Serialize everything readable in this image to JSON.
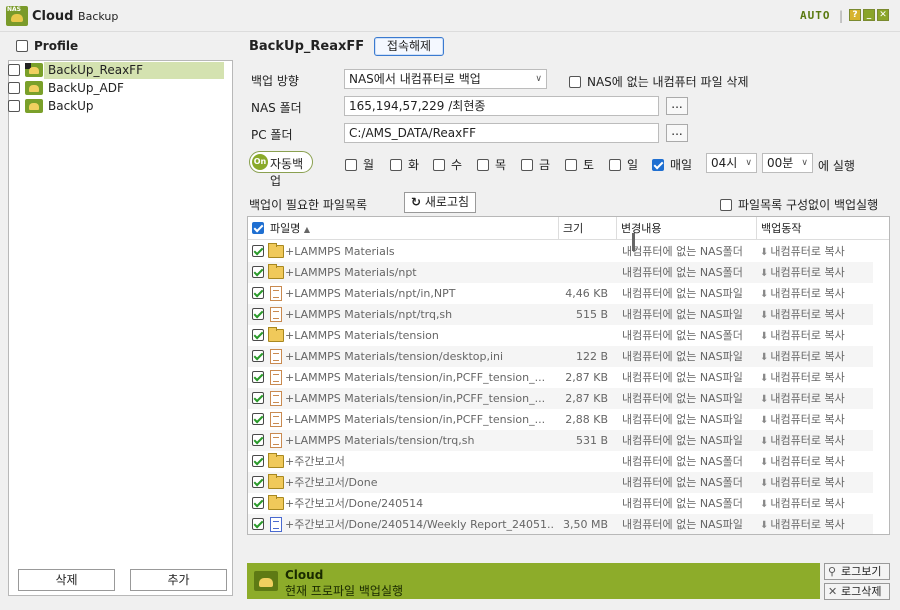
{
  "window": {
    "app_name": "Cloud",
    "app_sub": "Backup",
    "logo_text": "NAS",
    "auto_label": "AUTO",
    "separator": "|",
    "help": "?",
    "minimize": "_",
    "close": "✕"
  },
  "sidebar": {
    "header": "Profile",
    "items": [
      {
        "label": "BackUp_ReaxFF",
        "selected": true
      },
      {
        "label": "BackUp_ADF",
        "selected": false
      },
      {
        "label": "BackUp",
        "selected": false
      }
    ],
    "delete_label": "삭제",
    "add_label": "추가"
  },
  "profile": {
    "name": "BackUp_ReaxFF",
    "disconnect_label": "접속해제",
    "direction_label": "백업 방향",
    "direction_value": "NAS에서 내컴퓨터로 백업",
    "delete_missing_label": "NAS에 없는 내컴퓨터 파일 삭제",
    "nas_folder_label": "NAS 폴더",
    "nas_folder_value": "165,194,57,229 /최현종",
    "pc_folder_label": "PC 폴더",
    "pc_folder_value": "C:/AMS_DATA/ReaxFF",
    "browse_label": "...",
    "auto_on": "On",
    "auto_label": "자동백업",
    "days": [
      "월",
      "화",
      "수",
      "목",
      "금",
      "토",
      "일",
      "매일"
    ],
    "hour": "04시",
    "minute": "00분",
    "run_label": "에 실행"
  },
  "filelist": {
    "title": "백업이 필요한 파일목록",
    "refresh_label": "새로고침",
    "refresh_icon": "↻",
    "no_list_label": "파일목록 구성없이 백업실행",
    "columns": {
      "name": "파일명",
      "sort_icon": "▲",
      "size": "크기",
      "change": "변경내용",
      "action": "백업동작"
    },
    "rows": [
      {
        "icon": "folder",
        "name": "+LAMMPS Materials",
        "size": "",
        "change": "내컴퓨터에 없는 NAS폴더",
        "action": "내컴퓨터로 복사"
      },
      {
        "icon": "folder",
        "name": "+LAMMPS Materials/npt",
        "size": "",
        "change": "내컴퓨터에 없는 NAS폴더",
        "action": "내컴퓨터로 복사"
      },
      {
        "icon": "doc",
        "name": "+LAMMPS Materials/npt/in,NPT",
        "size": "4,46 KB",
        "change": "내컴퓨터에 없는 NAS파일",
        "action": "내컴퓨터로 복사"
      },
      {
        "icon": "doc",
        "name": "+LAMMPS Materials/npt/trq,sh",
        "size": "515 B",
        "change": "내컴퓨터에 없는 NAS파일",
        "action": "내컴퓨터로 복사"
      },
      {
        "icon": "folder",
        "name": "+LAMMPS Materials/tension",
        "size": "",
        "change": "내컴퓨터에 없는 NAS폴더",
        "action": "내컴퓨터로 복사"
      },
      {
        "icon": "doc",
        "name": "+LAMMPS Materials/tension/desktop,ini",
        "size": "122 B",
        "change": "내컴퓨터에 없는 NAS파일",
        "action": "내컴퓨터로 복사"
      },
      {
        "icon": "doc",
        "name": "+LAMMPS Materials/tension/in,PCFF_tension_...",
        "size": "2,87 KB",
        "change": "내컴퓨터에 없는 NAS파일",
        "action": "내컴퓨터로 복사"
      },
      {
        "icon": "doc",
        "name": "+LAMMPS Materials/tension/in,PCFF_tension_...",
        "size": "2,87 KB",
        "change": "내컴퓨터에 없는 NAS파일",
        "action": "내컴퓨터로 복사"
      },
      {
        "icon": "doc",
        "name": "+LAMMPS Materials/tension/in,PCFF_tension_...",
        "size": "2,88 KB",
        "change": "내컴퓨터에 없는 NAS파일",
        "action": "내컴퓨터로 복사"
      },
      {
        "icon": "doc",
        "name": "+LAMMPS Materials/tension/trq,sh",
        "size": "531 B",
        "change": "내컴퓨터에 없는 NAS파일",
        "action": "내컴퓨터로 복사"
      },
      {
        "icon": "folder",
        "name": "+주간보고서",
        "size": "",
        "change": "내컴퓨터에 없는 NAS폴더",
        "action": "내컴퓨터로 복사"
      },
      {
        "icon": "folder",
        "name": "+주간보고서/Done",
        "size": "",
        "change": "내컴퓨터에 없는 NAS폴더",
        "action": "내컴퓨터로 복사"
      },
      {
        "icon": "folder",
        "name": "+주간보고서/Done/240514",
        "size": "",
        "change": "내컴퓨터에 없는 NAS폴더",
        "action": "내컴퓨터로 복사"
      },
      {
        "icon": "doc-blue",
        "name": "+주간보고서/Done/240514/Weekly Report_24051...",
        "size": "3,50 MB",
        "change": "내컴퓨터에 없는 NAS파일",
        "action": "내컴퓨터로 복사"
      }
    ]
  },
  "status": {
    "title": "Cloud",
    "text": "현재 프로파일 백업실행",
    "log_view_label": "로그보기",
    "log_view_icon": "🔍",
    "log_delete_label": "로그삭제",
    "log_delete_icon": "✕"
  },
  "colors": {
    "accent": "#8dac2a",
    "selected_row": "#d4e2b0",
    "checkbox_blue": "#1f6fd1"
  }
}
